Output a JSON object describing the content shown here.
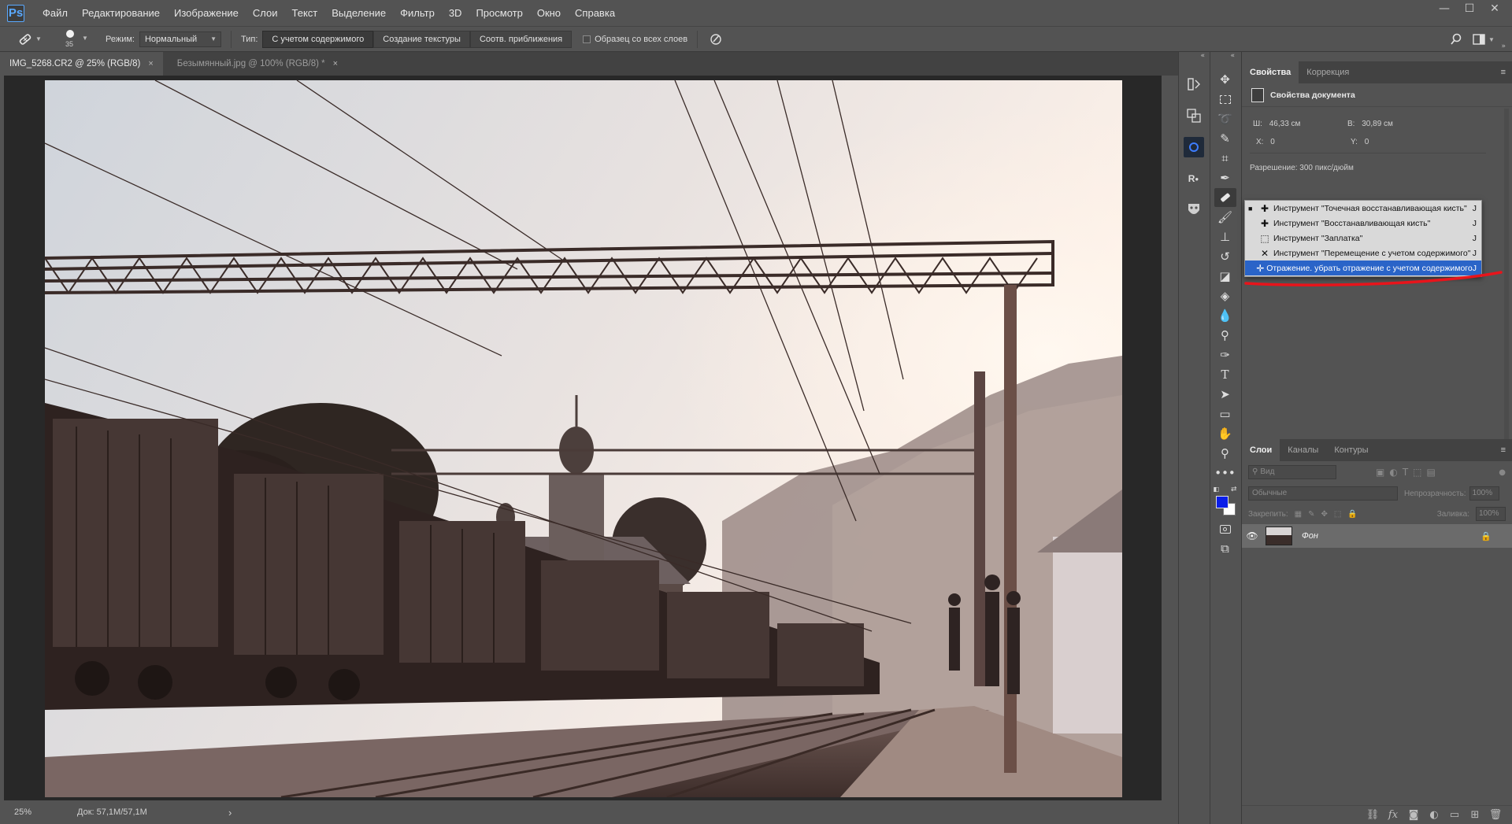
{
  "app": {
    "logo": "Ps"
  },
  "menu": [
    "Файл",
    "Редактирование",
    "Изображение",
    "Слои",
    "Текст",
    "Выделение",
    "Фильтр",
    "3D",
    "Просмотр",
    "Окно",
    "Справка"
  ],
  "window_controls": {
    "minimize": "—",
    "maximize": "☐",
    "close": "✕"
  },
  "options": {
    "brush_size": "35",
    "mode_label": "Режим:",
    "mode_value": "Нормальный",
    "type_label": "Тип:",
    "type_options": [
      "С учетом содержимого",
      "Создание текстуры",
      "Соотв. приближения"
    ],
    "type_selected": "С учетом содержимого",
    "sample_all_label": "Образец со всех слоев",
    "sample_all_checked": false
  },
  "tabs": [
    {
      "label": "IMG_5268.CR2 @ 25% (RGB/8)",
      "close": "×",
      "active": true
    },
    {
      "label": "Безымянный.jpg @ 100% (RGB/8) *",
      "close": "×",
      "active": false
    }
  ],
  "status": {
    "zoom": "25%",
    "doc": "Док: 57,1M/57,1M",
    "arrow": "›"
  },
  "properties": {
    "tabs": [
      "Свойства",
      "Коррекция"
    ],
    "section_title": "Свойства документа",
    "w_label": "Ш:",
    "w_value": "46,33 см",
    "h_label": "В:",
    "h_value": "30,89 см",
    "x_label": "X:",
    "x_value": "0",
    "y_label": "Y:",
    "y_value": "0",
    "resolution": "Разрешение: 300 пикс/дюйм"
  },
  "flyout": {
    "items": [
      {
        "label": "Инструмент \"Точечная восстанавливающая кисть\"",
        "key": "J",
        "icon": "spot-healing-brush-icon",
        "selected": true
      },
      {
        "label": "Инструмент \"Восстанавливающая кисть\"",
        "key": "J",
        "icon": "healing-brush-icon",
        "selected": false
      },
      {
        "label": "Инструмент \"Заплатка\"",
        "key": "J",
        "icon": "patch-icon",
        "selected": false
      },
      {
        "label": "Инструмент \"Перемещение с учетом содержимого\"",
        "key": "J",
        "icon": "content-aware-move-icon",
        "selected": false
      },
      {
        "label": "Отражение. убрать отражение с учетом содержимого",
        "key": "J",
        "icon": "red-eye-icon",
        "selected": false,
        "highlighted": true
      }
    ],
    "annotation_color": "#e8141b"
  },
  "layers": {
    "tabs": [
      "Слои",
      "Каналы",
      "Контуры"
    ],
    "search_placeholder": "Вид",
    "blend_mode": "Обычные",
    "opacity_label": "Непрозрачность:",
    "opacity_value": "100%",
    "lock_label": "Закрепить:",
    "fill_label": "Заливка:",
    "fill_value": "100%",
    "rows": [
      {
        "name": "Фон",
        "visible": true,
        "locked": true
      }
    ]
  },
  "colors": {
    "foreground": "#0a1ee8",
    "background": "#ffffff"
  }
}
